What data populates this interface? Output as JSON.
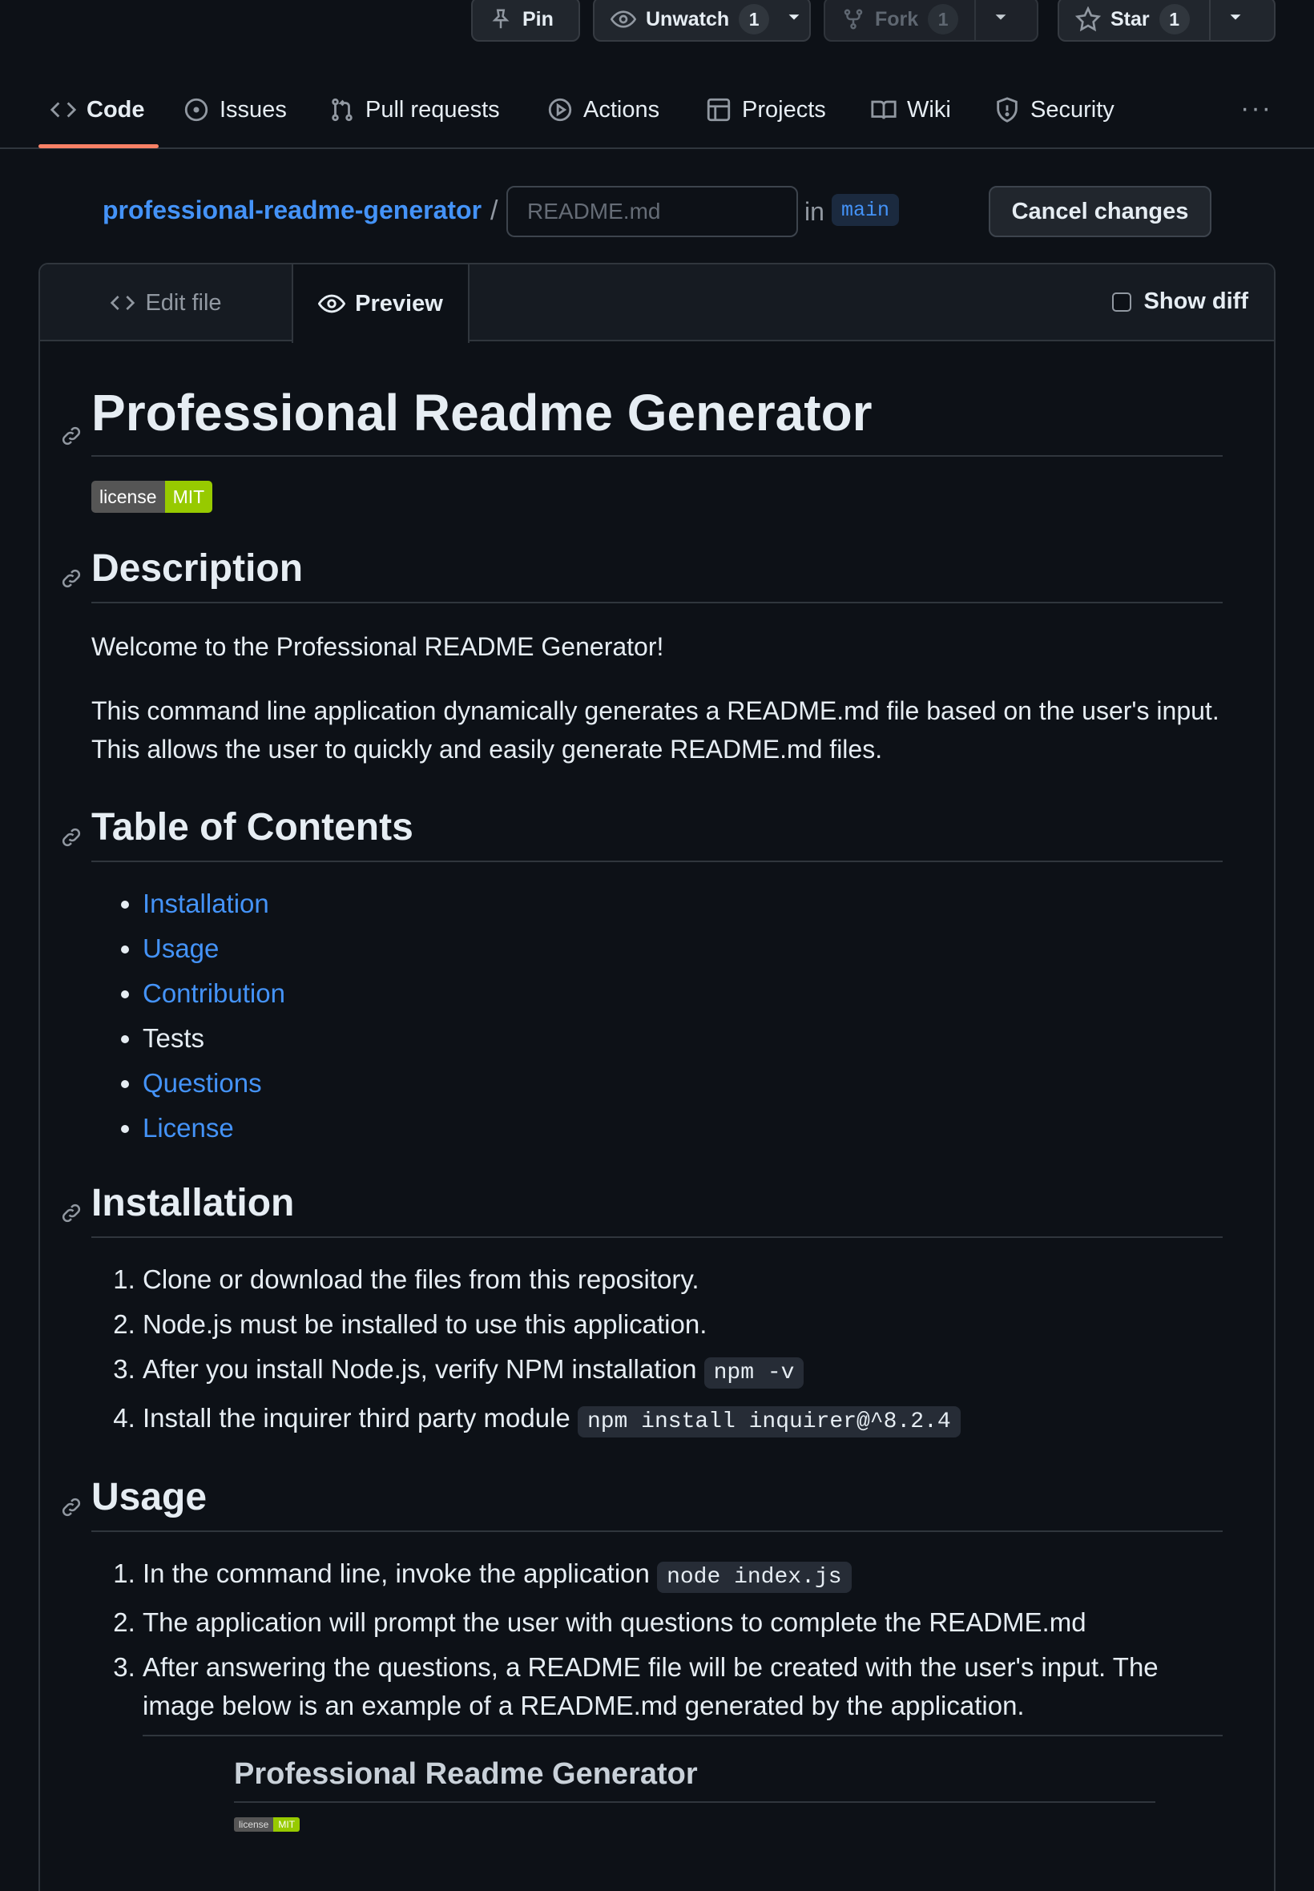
{
  "top_actions": {
    "pin_label": "Pin",
    "unwatch_label": "Unwatch",
    "unwatch_count": "1",
    "fork_label": "Fork",
    "fork_count": "1",
    "star_label": "Star",
    "star_count": "1"
  },
  "repo_nav": {
    "tabs": [
      {
        "label": "Code",
        "icon": "code-icon",
        "active": true
      },
      {
        "label": "Issues",
        "icon": "issue-icon"
      },
      {
        "label": "Pull requests",
        "icon": "pull-request-icon"
      },
      {
        "label": "Actions",
        "icon": "play-icon"
      },
      {
        "label": "Projects",
        "icon": "table-icon"
      },
      {
        "label": "Wiki",
        "icon": "book-icon"
      },
      {
        "label": "Security",
        "icon": "shield-icon"
      }
    ],
    "more_label": "···"
  },
  "breadcrumb": {
    "repo": "professional-readme-generator",
    "separator": "/",
    "filename_placeholder": "README.md",
    "in_label": "in",
    "branch": "main",
    "cancel_label": "Cancel changes"
  },
  "editor": {
    "edit_tab": "Edit file",
    "preview_tab": "Preview",
    "show_diff": "Show diff"
  },
  "readme": {
    "title": "Professional Readme Generator",
    "badge_left": "license",
    "badge_right": "MIT",
    "description_heading": "Description",
    "description_p1": "Welcome to the Professional README Generator!",
    "description_p2": "This command line application dynamically generates a README.md file based on the user's input. This allows the user to quickly and easily generate README.md files.",
    "toc_heading": "Table of Contents",
    "toc": [
      {
        "label": "Installation",
        "link": true
      },
      {
        "label": "Usage",
        "link": true
      },
      {
        "label": "Contribution",
        "link": true
      },
      {
        "label": "Tests",
        "link": false
      },
      {
        "label": "Questions",
        "link": true
      },
      {
        "label": "License",
        "link": true
      }
    ],
    "installation_heading": "Installation",
    "installation_steps": [
      {
        "text": "Clone or download the files from this repository.",
        "code": ""
      },
      {
        "text": "Node.js must be installed to use this application.",
        "code": ""
      },
      {
        "text": "After you install Node.js, verify NPM installation",
        "code": "npm -v"
      },
      {
        "text": "Install the inquirer third party module",
        "code": "npm install inquirer@^8.2.4"
      }
    ],
    "usage_heading": "Usage",
    "usage_steps": [
      {
        "text": "In the command line, invoke the application",
        "code": "node index.js"
      },
      {
        "text": "The application will prompt the user with questions to complete the README.md",
        "code": ""
      },
      {
        "text": "After answering the questions, a README file will be created with the user's input. The image below is an example of a README.md generated by the application.",
        "code": ""
      }
    ],
    "embedded_image": {
      "title": "Professional Readme Generator",
      "badge_left": "license",
      "badge_right": "MIT"
    }
  },
  "colors": {
    "background": "#0d1117",
    "accent_link": "#4493f8",
    "tab_underline": "#f78166",
    "badge_green": "#97ca00"
  }
}
